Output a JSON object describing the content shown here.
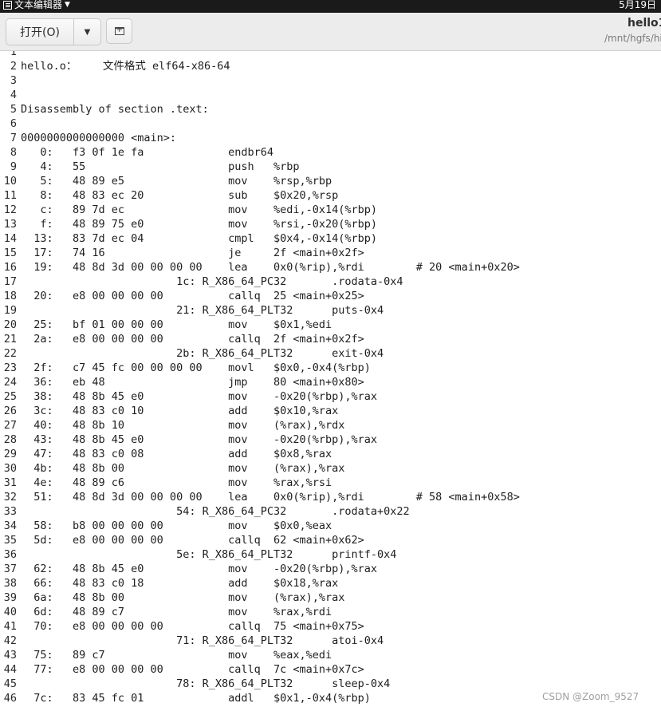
{
  "system": {
    "app_name": "文本编辑器",
    "clock": "5月19日"
  },
  "header": {
    "open_label": "打开(O)",
    "doc_title": "hello1",
    "doc_path": "/mnt/hgfs/hi"
  },
  "editor": {
    "lines": [
      {
        "n": "1",
        "t": ""
      },
      {
        "n": "2",
        "t": "hello.o：    文件格式 elf64-x86-64"
      },
      {
        "n": "3",
        "t": ""
      },
      {
        "n": "4",
        "t": ""
      },
      {
        "n": "5",
        "t": "Disassembly of section .text:"
      },
      {
        "n": "6",
        "t": ""
      },
      {
        "n": "7",
        "t": "0000000000000000 <main>:"
      },
      {
        "n": "8",
        "t": "   0:   f3 0f 1e fa             endbr64"
      },
      {
        "n": "9",
        "t": "   4:   55                      push   %rbp"
      },
      {
        "n": "10",
        "t": "   5:   48 89 e5                mov    %rsp,%rbp"
      },
      {
        "n": "11",
        "t": "   8:   48 83 ec 20             sub    $0x20,%rsp"
      },
      {
        "n": "12",
        "t": "   c:   89 7d ec                mov    %edi,-0x14(%rbp)"
      },
      {
        "n": "13",
        "t": "   f:   48 89 75 e0             mov    %rsi,-0x20(%rbp)"
      },
      {
        "n": "14",
        "t": "  13:   83 7d ec 04             cmpl   $0x4,-0x14(%rbp)"
      },
      {
        "n": "15",
        "t": "  17:   74 16                   je     2f <main+0x2f>"
      },
      {
        "n": "16",
        "t": "  19:   48 8d 3d 00 00 00 00    lea    0x0(%rip),%rdi        # 20 <main+0x20>"
      },
      {
        "n": "17",
        "t": "                        1c: R_X86_64_PC32       .rodata-0x4"
      },
      {
        "n": "18",
        "t": "  20:   e8 00 00 00 00          callq  25 <main+0x25>"
      },
      {
        "n": "19",
        "t": "                        21: R_X86_64_PLT32      puts-0x4"
      },
      {
        "n": "20",
        "t": "  25:   bf 01 00 00 00          mov    $0x1,%edi"
      },
      {
        "n": "21",
        "t": "  2a:   e8 00 00 00 00          callq  2f <main+0x2f>"
      },
      {
        "n": "22",
        "t": "                        2b: R_X86_64_PLT32      exit-0x4"
      },
      {
        "n": "23",
        "t": "  2f:   c7 45 fc 00 00 00 00    movl   $0x0,-0x4(%rbp)"
      },
      {
        "n": "24",
        "t": "  36:   eb 48                   jmp    80 <main+0x80>"
      },
      {
        "n": "25",
        "t": "  38:   48 8b 45 e0             mov    -0x20(%rbp),%rax"
      },
      {
        "n": "26",
        "t": "  3c:   48 83 c0 10             add    $0x10,%rax"
      },
      {
        "n": "27",
        "t": "  40:   48 8b 10                mov    (%rax),%rdx"
      },
      {
        "n": "28",
        "t": "  43:   48 8b 45 e0             mov    -0x20(%rbp),%rax"
      },
      {
        "n": "29",
        "t": "  47:   48 83 c0 08             add    $0x8,%rax"
      },
      {
        "n": "30",
        "t": "  4b:   48 8b 00                mov    (%rax),%rax"
      },
      {
        "n": "31",
        "t": "  4e:   48 89 c6                mov    %rax,%rsi"
      },
      {
        "n": "32",
        "t": "  51:   48 8d 3d 00 00 00 00    lea    0x0(%rip),%rdi        # 58 <main+0x58>"
      },
      {
        "n": "33",
        "t": "                        54: R_X86_64_PC32       .rodata+0x22"
      },
      {
        "n": "34",
        "t": "  58:   b8 00 00 00 00          mov    $0x0,%eax"
      },
      {
        "n": "35",
        "t": "  5d:   e8 00 00 00 00          callq  62 <main+0x62>"
      },
      {
        "n": "36",
        "t": "                        5e: R_X86_64_PLT32      printf-0x4"
      },
      {
        "n": "37",
        "t": "  62:   48 8b 45 e0             mov    -0x20(%rbp),%rax"
      },
      {
        "n": "38",
        "t": "  66:   48 83 c0 18             add    $0x18,%rax"
      },
      {
        "n": "39",
        "t": "  6a:   48 8b 00                mov    (%rax),%rax"
      },
      {
        "n": "40",
        "t": "  6d:   48 89 c7                mov    %rax,%rdi"
      },
      {
        "n": "41",
        "t": "  70:   e8 00 00 00 00          callq  75 <main+0x75>"
      },
      {
        "n": "42",
        "t": "                        71: R_X86_64_PLT32      atoi-0x4"
      },
      {
        "n": "43",
        "t": "  75:   89 c7                   mov    %eax,%edi"
      },
      {
        "n": "44",
        "t": "  77:   e8 00 00 00 00          callq  7c <main+0x7c>"
      },
      {
        "n": "45",
        "t": "                        78: R_X86_64_PLT32      sleep-0x4"
      },
      {
        "n": "46",
        "t": "  7c:   83 45 fc 01             addl   $0x1,-0x4(%rbp)"
      }
    ]
  },
  "watermark": "CSDN @Zoom_9527"
}
